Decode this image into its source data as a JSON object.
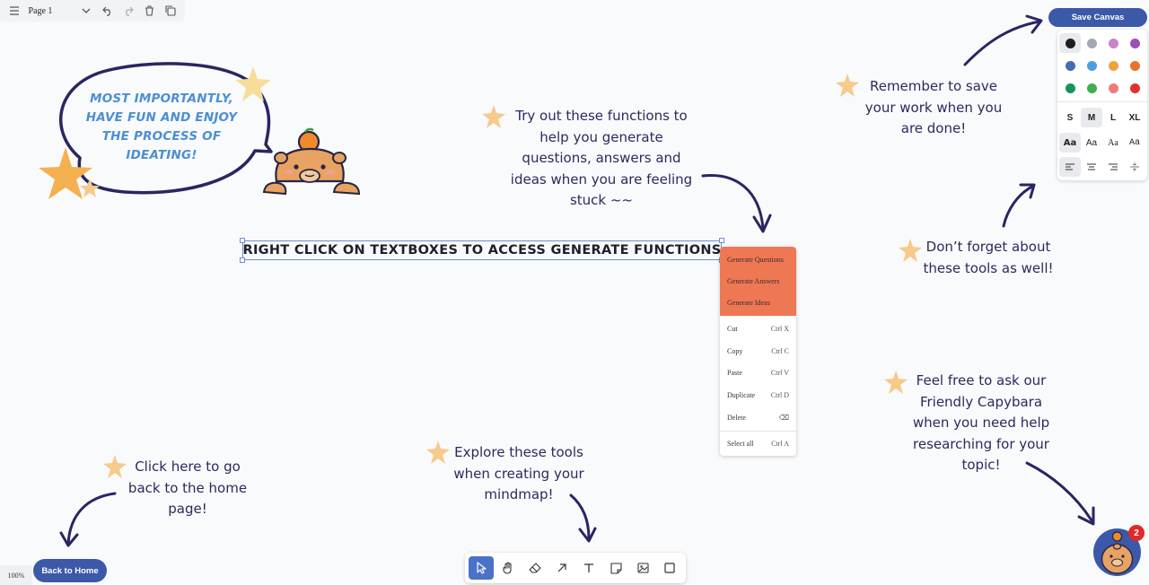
{
  "pagebar": {
    "page_name": "Page 1"
  },
  "save": {
    "label": "Save Canvas"
  },
  "style_panel": {
    "colors": [
      "#1e1e1e",
      "#a3a8b3",
      "#c784c9",
      "#9b4fb0",
      "#4969b8",
      "#4a9ee0",
      "#f0a33c",
      "#e8742b",
      "#13935a",
      "#3fae4f",
      "#f07a7a",
      "#e03131"
    ],
    "sizes": [
      "S",
      "M",
      "L",
      "XL"
    ],
    "fonts": [
      "Aa",
      "Aa",
      "Aa",
      "Aa"
    ]
  },
  "bubble": {
    "text": "MOST IMPORTANTLY, HAVE FUN AND ENJOY THE PROCESS OF IDEATING!"
  },
  "title_box": {
    "text": "RIGHT CLICK ON TEXTBOXES TO ACCESS GENERATE FUNCTIONS"
  },
  "notes": {
    "functions": "Try out these functions to help you generate questions, answers and ideas when you are feeling stuck ~~",
    "save": "Remember to save your work when you are done!",
    "tools": "Don’t forget about these tools as well!",
    "capybara": "Feel free to ask our Friendly Capybara when you need help researching for your topic!",
    "explore": "Explore these tools when creating your mindmap!",
    "home": "Click here to go back to the home page!"
  },
  "context_menu": {
    "generate": [
      "Generate Questions",
      "Generate Answers",
      "Generate Ideas"
    ],
    "items": [
      {
        "label": "Cut",
        "shortcut": "Ctrl X"
      },
      {
        "label": "Copy",
        "shortcut": "Ctrl C"
      },
      {
        "label": "Paste",
        "shortcut": "Ctrl V"
      },
      {
        "label": "Duplicate",
        "shortcut": "Ctrl D"
      },
      {
        "label": "Delete",
        "shortcut": "⌫"
      },
      {
        "label": "Select all",
        "shortcut": "Ctrl A"
      }
    ]
  },
  "toolbar": {
    "tools": [
      "select-icon",
      "hand-icon",
      "eraser-icon",
      "arrow-icon",
      "text-icon",
      "note-icon",
      "image-icon",
      "rectangle-icon"
    ]
  },
  "back_home": {
    "label": "Back to Home"
  },
  "zoom": {
    "level": "100%"
  },
  "chat": {
    "badge": "2"
  },
  "theme": {
    "accent": "#3b58a9",
    "menu_highlight": "#ee7854",
    "note_text": "#2b2a5c",
    "star": "#f5b968"
  }
}
